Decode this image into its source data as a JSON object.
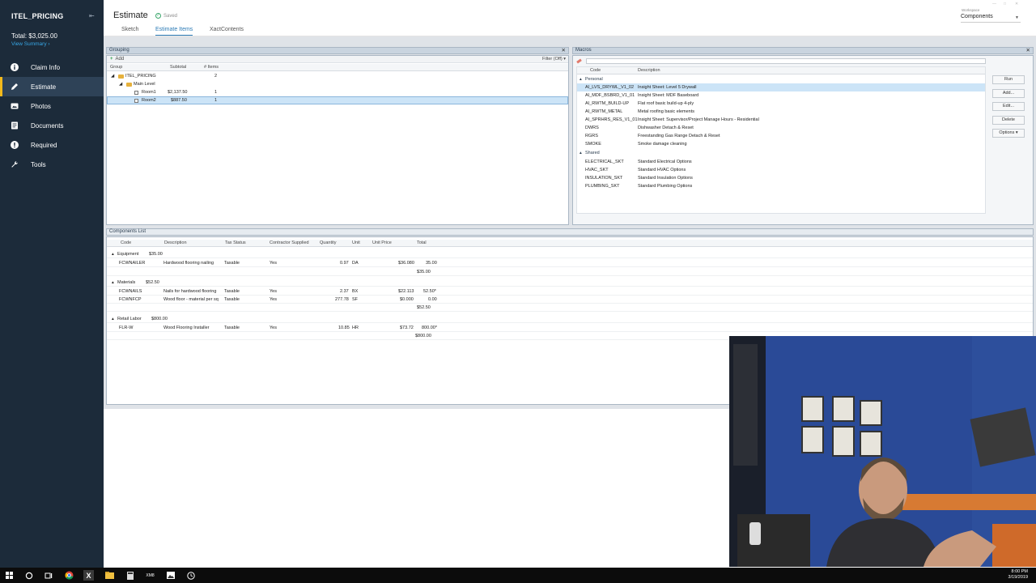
{
  "sidebar": {
    "title": "ITEL_PRICING",
    "total": "Total: $3,025.00",
    "view_summary": "View Summary",
    "items": [
      {
        "label": "Claim Info",
        "icon": "info-icon"
      },
      {
        "label": "Estimate",
        "icon": "pencil-icon"
      },
      {
        "label": "Photos",
        "icon": "photo-icon"
      },
      {
        "label": "Documents",
        "icon": "document-icon"
      },
      {
        "label": "Required",
        "icon": "alert-icon"
      },
      {
        "label": "Tools",
        "icon": "wrench-icon"
      }
    ]
  },
  "header": {
    "title": "Estimate",
    "saved": "Saved",
    "tabs": [
      "Sketch",
      "Estimate Items",
      "XactContents"
    ],
    "workspace_label": "Workspace",
    "workspace_value": "Components"
  },
  "grouping": {
    "title": "Grouping",
    "add": "Add",
    "filter": "Filter (Off)",
    "columns": [
      "Group",
      "Subtotal",
      "# Items"
    ],
    "rows": [
      {
        "name": "ITEL_PRICING",
        "subtotal": "",
        "items": "2"
      },
      {
        "name": "Main Level",
        "subtotal": "",
        "items": ""
      },
      {
        "name": "Room1",
        "subtotal": "$2,137.50",
        "items": "1"
      },
      {
        "name": "Room2",
        "subtotal": "$887.50",
        "items": "1"
      }
    ]
  },
  "macros": {
    "title": "Macros",
    "columns": [
      "Code",
      "Description"
    ],
    "personal_label": "Personal",
    "shared_label": "Shared",
    "personal": [
      {
        "code": "AI_LVS_DRYWL_V1_02",
        "desc": "Insight Sheet: Level 5 Drywall"
      },
      {
        "code": "AI_MDF_BSBRD_V1_01",
        "desc": "Insight Sheet: MDF Baseboard"
      },
      {
        "code": "AI_RWTM_BUILD-UP",
        "desc": "Flat roof basic build-up 4-ply"
      },
      {
        "code": "AI_RWTM_METAL",
        "desc": "Metal roofing basic elements"
      },
      {
        "code": "AI_SPRHRS_RES_V1_01",
        "desc": "Insight Sheet: Supervisor/Project Manage Hours - Residential"
      },
      {
        "code": "DWRS",
        "desc": "Dishwasher Detach & Reset"
      },
      {
        "code": "RGRS",
        "desc": "Freestanding Gas Range Detach & Reset"
      },
      {
        "code": "SMOKE",
        "desc": "Smoke damage cleaning"
      }
    ],
    "shared": [
      {
        "code": "ELECTRICAL_SKT",
        "desc": "Standard Electrical Options"
      },
      {
        "code": "HVAC_SKT",
        "desc": "Standard HVAC Options"
      },
      {
        "code": "INSULATION_SKT",
        "desc": "Standard Insulation Options"
      },
      {
        "code": "PLUMBING_SKT",
        "desc": "Standard Plumbing Options"
      }
    ],
    "buttons": [
      "Run",
      "Add...",
      "Edit...",
      "Delete",
      "Options"
    ]
  },
  "components": {
    "title": "Components List",
    "columns": [
      "Code",
      "Description",
      "Tax Status",
      "Contractor Supplied",
      "Quantity",
      "Unit",
      "Unit Price",
      "Total"
    ],
    "groups": [
      {
        "name": "Equipment",
        "amount": "$35.00",
        "rows": [
          {
            "code": "FCWNAILER",
            "desc": "Hardwood flooring nailing",
            "tax": "Taxable",
            "supplied": "Yes",
            "qty": "0.97",
            "unit": "DA",
            "price": "$36.080",
            "total": "35.00"
          }
        ],
        "subtotal": "$35.00"
      },
      {
        "name": "Materials",
        "amount": "$52.50",
        "rows": [
          {
            "code": "FCWNAILS",
            "desc": "Nails for hardwood flooring",
            "tax": "Taxable",
            "supplied": "Yes",
            "qty": "2.37",
            "unit": "BX",
            "price": "$22.113",
            "total": "52.50*"
          },
          {
            "code": "FCWNFCP",
            "desc": "Wood floor - material per sq",
            "tax": "Taxable",
            "supplied": "Yes",
            "qty": "277.78",
            "unit": "SF",
            "price": "$0.000",
            "total": "0.00"
          }
        ],
        "subtotal": "$52.50"
      },
      {
        "name": "Retail Labor",
        "amount": "$800.00",
        "rows": [
          {
            "code": "FLR-W",
            "desc": "Wood Flooring Installer",
            "tax": "Taxable",
            "supplied": "Yes",
            "qty": "10.85",
            "unit": "HR",
            "price": "$73.72",
            "total": "800.00*"
          }
        ],
        "subtotal": "$800.00"
      }
    ]
  },
  "taskbar": {
    "time": "8:00 PM",
    "date": "3/19/2019"
  },
  "colors": {
    "sidebar_bg": "#1c2b3a",
    "accent_yellow": "#f2b91c",
    "link_blue": "#2c7bb6"
  }
}
